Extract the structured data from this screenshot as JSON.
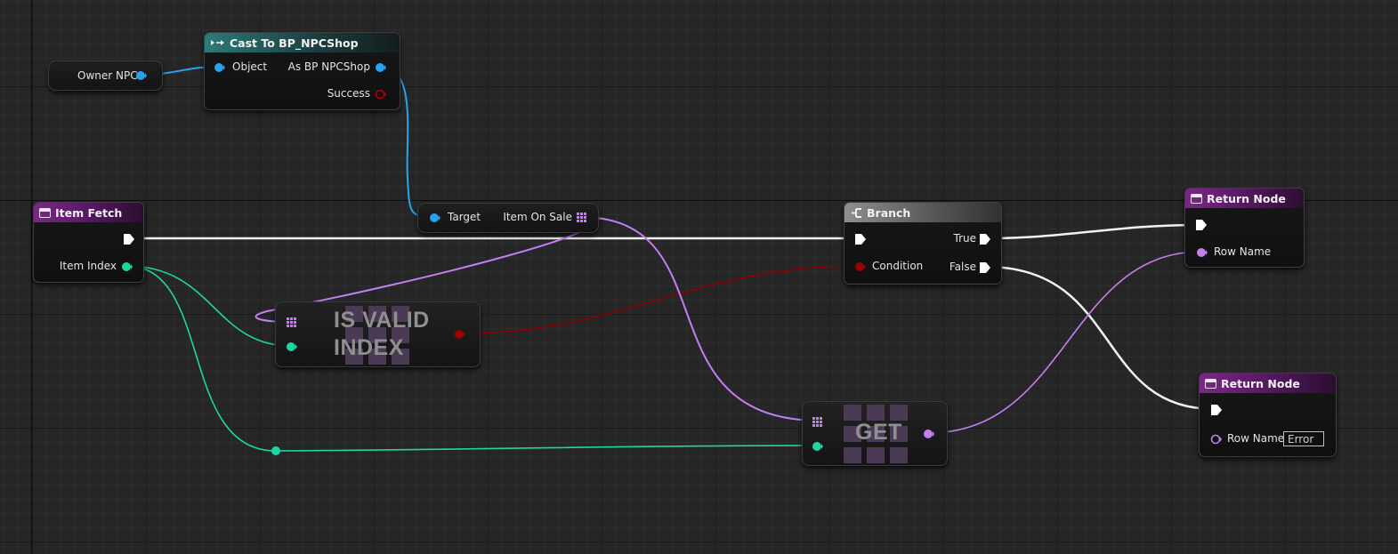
{
  "colors": {
    "object_pin": "#29a3ef",
    "bool_pin": "#8c0000",
    "int_pin": "#1dd6a2",
    "name_pin": "#c57ef2",
    "exec_pin": "#ffffff"
  },
  "nodes": {
    "owner_npc": {
      "label": "Owner NPC"
    },
    "cast": {
      "title": "Cast To BP_NPCShop",
      "pin_object": "Object",
      "pin_as": "As BP NPCShop",
      "pin_success": "Success"
    },
    "item_fetch": {
      "title": "Item Fetch",
      "pin_item_index": "Item Index"
    },
    "item_on_sale": {
      "pin_target": "Target",
      "pin_item_on_sale": "Item On Sale"
    },
    "is_valid_index": {
      "title_line1": "IS VALID",
      "title_line2": "INDEX"
    },
    "branch": {
      "title": "Branch",
      "pin_condition": "Condition",
      "pin_true": "True",
      "pin_false": "False"
    },
    "return_node_top": {
      "title": "Return Node",
      "pin_row_name": "Row Name"
    },
    "get": {
      "title": "GET"
    },
    "return_node_bottom": {
      "title": "Return Node",
      "pin_row_name": "Row Name",
      "row_name_value": "Error"
    }
  }
}
